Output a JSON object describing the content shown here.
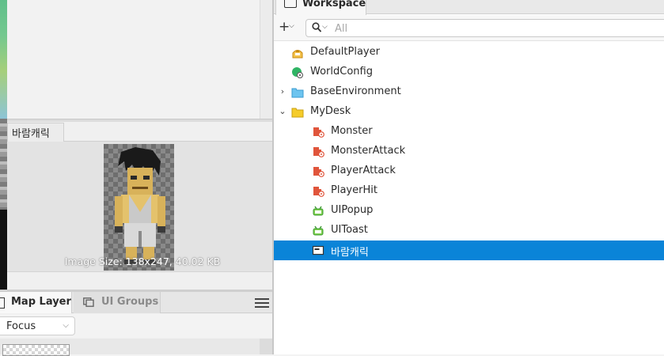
{
  "preview": {
    "tab_label": "바람캐릭",
    "image_size": "Image Size: 138x247, 40.02 KB"
  },
  "bottom_panel": {
    "tabs": [
      {
        "label": "Map Layer",
        "active": true
      },
      {
        "label": "UI Groups",
        "active": false
      }
    ],
    "focus_select": "Focus"
  },
  "workspace": {
    "tab_label": "Workspace",
    "add_label": "+",
    "search_placeholder": "All",
    "tree": [
      {
        "label": "DefaultPlayer",
        "icon": "player-icon",
        "expander": "",
        "depth": 0
      },
      {
        "label": "WorldConfig",
        "icon": "world-config-icon",
        "expander": "",
        "depth": 0
      },
      {
        "label": "BaseEnvironment",
        "icon": "folder-blue-icon",
        "expander": "›",
        "depth": 0
      },
      {
        "label": "MyDesk",
        "icon": "folder-yellow-icon",
        "expander": "⌄",
        "depth": 0
      },
      {
        "label": "Monster",
        "icon": "script-red-icon",
        "expander": "",
        "depth": 1
      },
      {
        "label": "MonsterAttack",
        "icon": "script-red-icon",
        "expander": "",
        "depth": 1
      },
      {
        "label": "PlayerAttack",
        "icon": "script-red-icon",
        "expander": "",
        "depth": 1
      },
      {
        "label": "PlayerHit",
        "icon": "script-red-icon",
        "expander": "",
        "depth": 1
      },
      {
        "label": "UIPopup",
        "icon": "ui-green-icon",
        "expander": "",
        "depth": 1
      },
      {
        "label": "UIToast",
        "icon": "ui-green-icon",
        "expander": "",
        "depth": 1
      },
      {
        "label": "바람캐릭",
        "icon": "image-icon",
        "expander": "",
        "depth": 1,
        "selected": true
      }
    ]
  },
  "colors": {
    "selection": "#0a84d8",
    "panel_bg": "#f0f0f0",
    "tree_bg": "#ffffff"
  }
}
